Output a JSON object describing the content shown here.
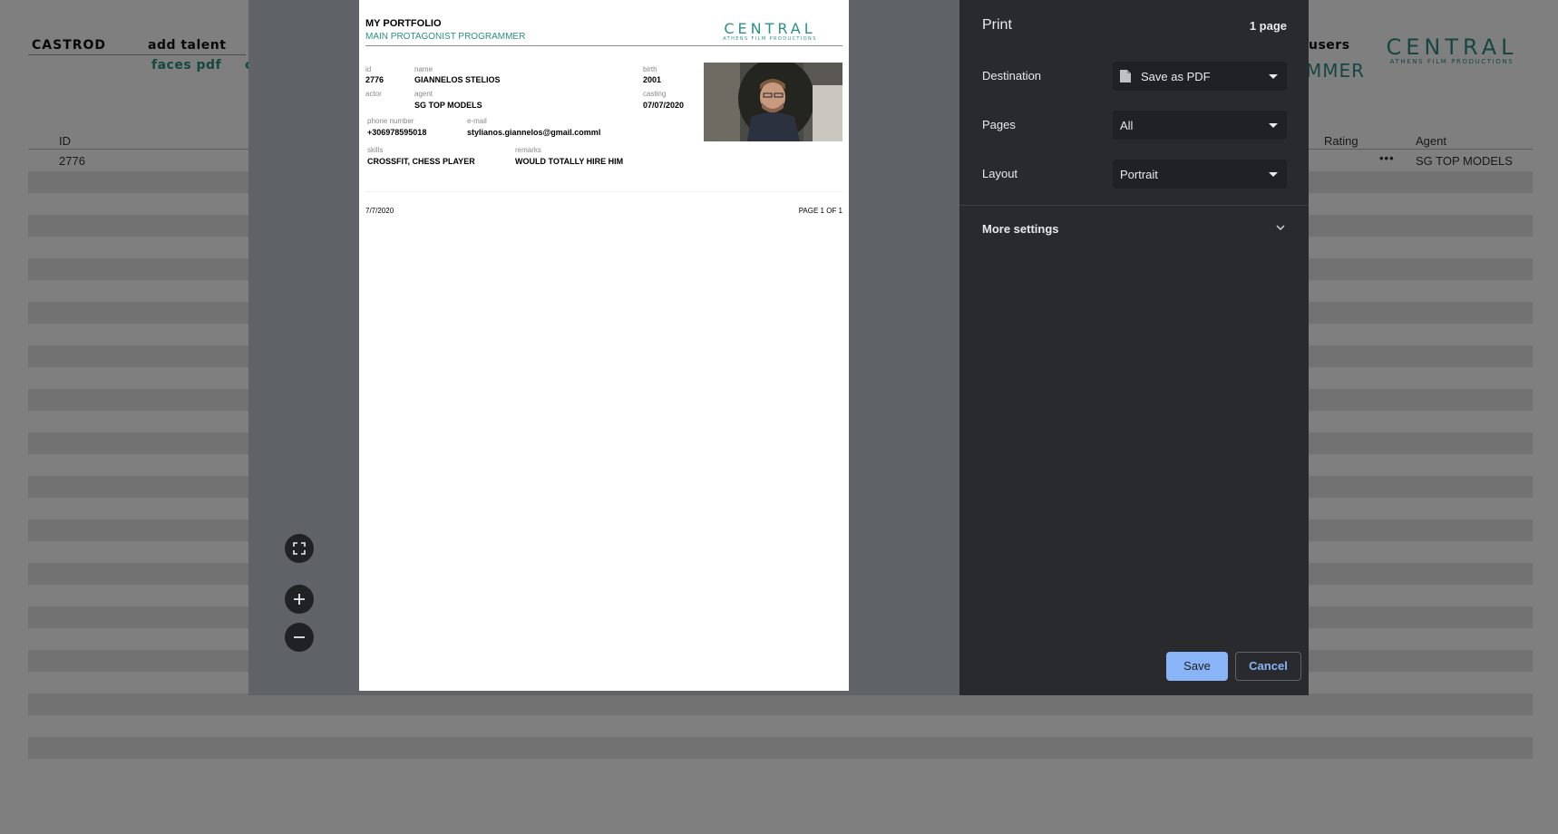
{
  "app": {
    "brand": "CASTROD",
    "nav_add_talent": "add talent",
    "nav_users": "users",
    "nav_faces_pdf": "faces pdf",
    "nav_partial": "c",
    "subtitle_partial": "MMER",
    "logo_main": "CENTRAL",
    "logo_sub": "ATHENS FILM PRODUCTIONS",
    "table": {
      "headers": {
        "id": "ID",
        "rating": "Rating",
        "agent": "Agent"
      },
      "row": {
        "id": "2776",
        "rating": "•••",
        "agent": "SG TOP MODELS"
      }
    }
  },
  "print": {
    "title": "Print",
    "page_count": "1 page",
    "destination_label": "Destination",
    "destination_value": "Save as PDF",
    "pages_label": "Pages",
    "pages_value": "All",
    "layout_label": "Layout",
    "layout_value": "Portrait",
    "more_settings": "More settings",
    "save_label": "Save",
    "cancel_label": "Cancel",
    "colors": {
      "panel": "#292a2d",
      "accent": "#8ab4f8",
      "preview_bg": "#5f6368"
    }
  },
  "preview": {
    "title": "MY PORTFOLIO",
    "subtitle": "MAIN PROTAGONIST PROGRAMMER",
    "logo_main": "CENTRAL",
    "logo_sub": "ATHENS FILM PRODUCTIONS",
    "fields": {
      "id_label": "id",
      "id": "2776",
      "name_label": "name",
      "name": "GIANNELOS STELIOS",
      "birth_label": "birth",
      "birth": "2001",
      "role": "actor",
      "agent_label": "agent",
      "agent": "SG TOP MODELS",
      "casting_label": "casting",
      "casting": "07/07/2020",
      "phone_label": "phone number",
      "phone": "+306978595018",
      "email_label": "e-mail",
      "email": "stylianos.giannelos@gmail.comml",
      "skills_label": "skills",
      "skills": "CROSSFIT, CHESS PLAYER",
      "remarks_label": "remarks",
      "remarks": "WOULD TOTALLY HIRE HIM"
    },
    "footer_date": "7/7/2020",
    "footer_pages": "PAGE 1 OF 1",
    "accent_color": "#2c8f86"
  },
  "icons": [
    "fit-to-page-icon",
    "zoom-in-icon",
    "zoom-out-icon",
    "file-icon",
    "chevron-down-icon"
  ]
}
